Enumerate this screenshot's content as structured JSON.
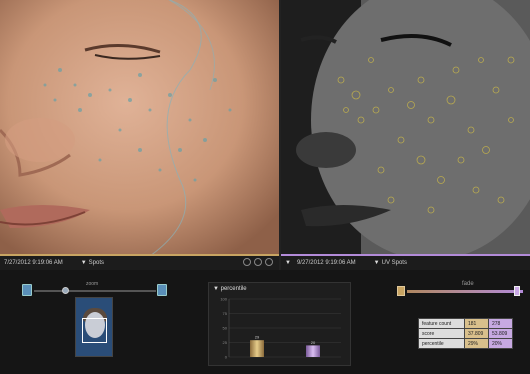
{
  "left_view": {
    "timestamp": "7/27/2012 9:19:06 AM",
    "mode": "Spots"
  },
  "right_view": {
    "timestamp": "9/27/2012 9:19:06 AM",
    "mode": "UV Spots"
  },
  "zoom": {
    "label": "zoom",
    "level": 0.25
  },
  "fade": {
    "label": "fade",
    "level": 0.95
  },
  "chart": {
    "title": "percentile"
  },
  "chart_data": {
    "type": "bar",
    "title": "percentile",
    "categories": [
      "Spots",
      "UV Spots"
    ],
    "values": [
      29,
      20
    ],
    "yticks": [
      "100",
      "75",
      "50",
      "25",
      "0"
    ],
    "ylim": [
      0,
      100
    ],
    "grid": true,
    "bar_labels": [
      "29",
      "20"
    ]
  },
  "stats": {
    "rows": [
      {
        "label": "feature count",
        "v1": "181",
        "v2": "278"
      },
      {
        "label": "score",
        "v1": "37.809",
        "v2": "53.809"
      },
      {
        "label": "percentile",
        "v1": "29%",
        "v2": "20%"
      }
    ]
  },
  "colors": {
    "left_accent": "#c8a462",
    "right_accent": "#b38bd9"
  },
  "icons": [
    "dropdown-arrow-icon",
    "palette-icon",
    "contrast-icon",
    "camera-icon",
    "zoom-out-icon",
    "zoom-in-icon",
    "fade-left-icon"
  ]
}
